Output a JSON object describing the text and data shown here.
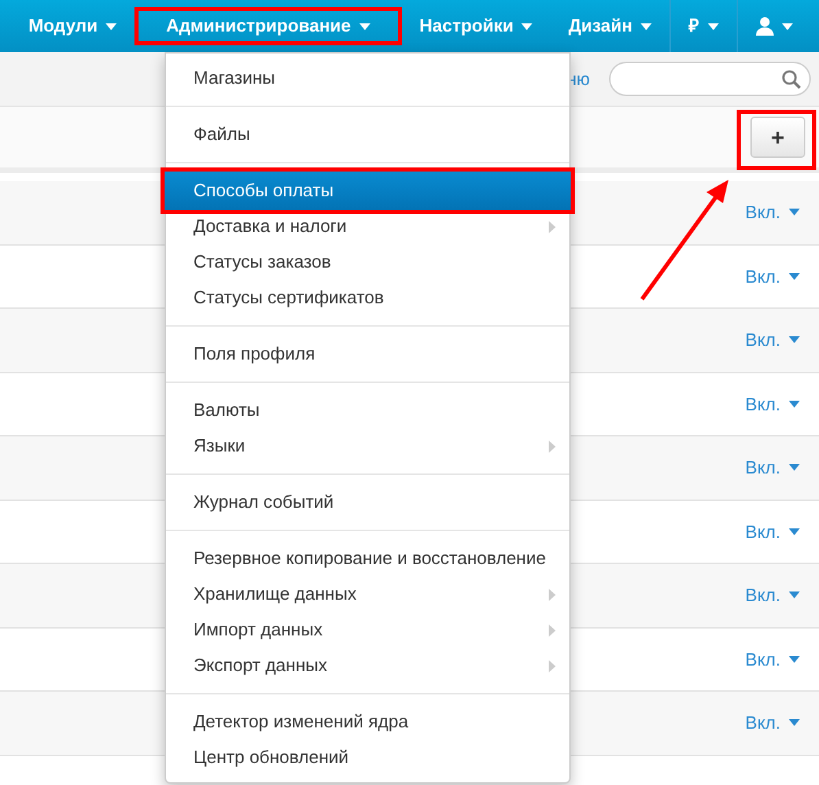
{
  "nav": [
    {
      "label": "Модули",
      "kind": "text",
      "annotated": false
    },
    {
      "label": "Администрирование",
      "kind": "text",
      "annotated": true
    },
    {
      "label": "Настройки",
      "kind": "text",
      "annotated": false
    },
    {
      "label": "Дизайн",
      "kind": "text",
      "annotated": false
    },
    {
      "label": "₽",
      "kind": "text",
      "annotated": false
    },
    {
      "kind": "user",
      "annotated": false
    }
  ],
  "toolbar": {
    "link": "ню"
  },
  "add_button": {
    "label": "+",
    "annotated": true
  },
  "menu": [
    [
      {
        "label": "Магазины",
        "selected": false,
        "submenu": false,
        "annotated": false
      }
    ],
    [
      {
        "label": "Файлы",
        "selected": false,
        "submenu": false,
        "annotated": false
      }
    ],
    [
      {
        "label": "Способы оплаты",
        "selected": true,
        "submenu": false,
        "annotated": true
      },
      {
        "label": "Доставка и налоги",
        "selected": false,
        "submenu": true,
        "annotated": false
      },
      {
        "label": "Статусы заказов",
        "selected": false,
        "submenu": false,
        "annotated": false
      },
      {
        "label": "Статусы сертификатов",
        "selected": false,
        "submenu": false,
        "annotated": false
      }
    ],
    [
      {
        "label": "Поля профиля",
        "selected": false,
        "submenu": false,
        "annotated": false
      }
    ],
    [
      {
        "label": "Валюты",
        "selected": false,
        "submenu": false,
        "annotated": false
      },
      {
        "label": "Языки",
        "selected": false,
        "submenu": true,
        "annotated": false
      }
    ],
    [
      {
        "label": "Журнал событий",
        "selected": false,
        "submenu": false,
        "annotated": false
      }
    ],
    [
      {
        "label": "Резервное копирование и восстановление",
        "selected": false,
        "submenu": false,
        "annotated": false
      },
      {
        "label": "Хранилище данных",
        "selected": false,
        "submenu": true,
        "annotated": false
      },
      {
        "label": "Импорт данных",
        "selected": false,
        "submenu": true,
        "annotated": false
      },
      {
        "label": "Экспорт данных",
        "selected": false,
        "submenu": true,
        "annotated": false
      }
    ],
    [
      {
        "label": "Детектор изменений ядра",
        "selected": false,
        "submenu": false,
        "annotated": false
      },
      {
        "label": "Центр обновлений",
        "selected": false,
        "submenu": false,
        "annotated": false
      }
    ]
  ],
  "rows": [
    {
      "status": "Вкл."
    },
    {
      "status": "Вкл."
    },
    {
      "status": "Вкл."
    },
    {
      "status": "Вкл."
    },
    {
      "status": "Вкл."
    },
    {
      "status": "Вкл."
    },
    {
      "status": "Вкл."
    },
    {
      "status": "Вкл."
    },
    {
      "status": "Вкл."
    }
  ]
}
